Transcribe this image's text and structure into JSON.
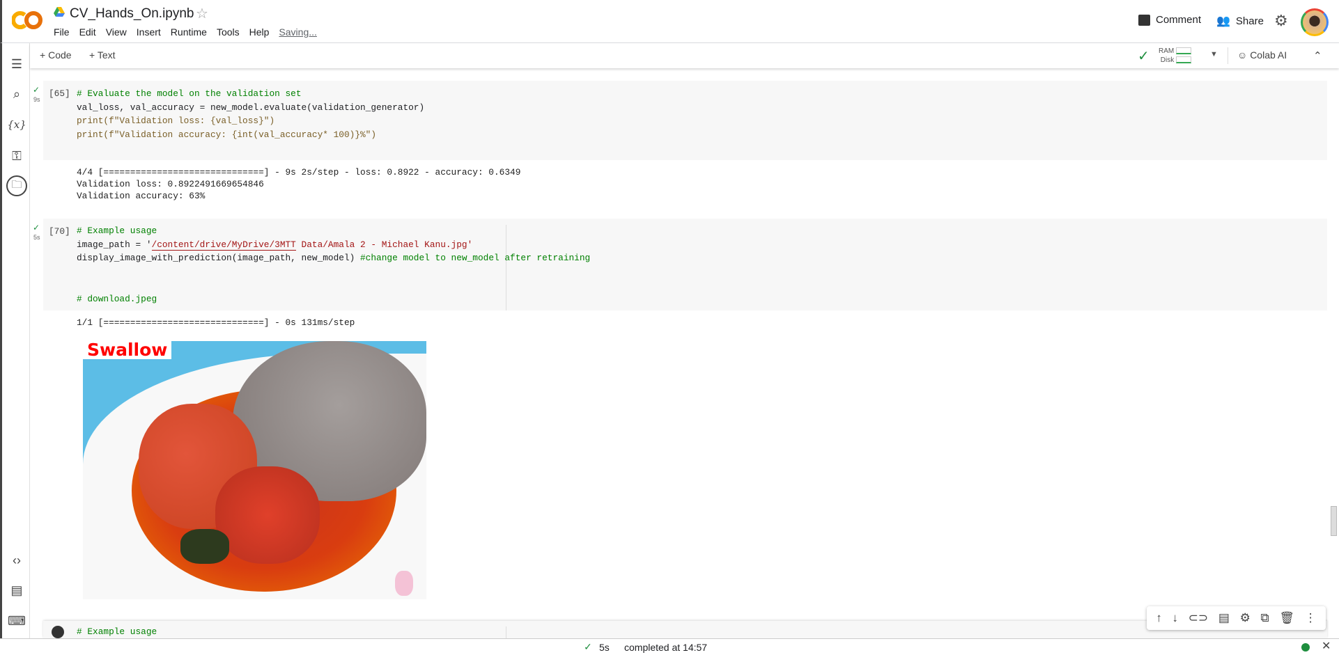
{
  "header": {
    "title": "CV_Hands_On.ipynb",
    "menu": [
      "File",
      "Edit",
      "View",
      "Insert",
      "Runtime",
      "Tools",
      "Help"
    ],
    "saving": "Saving...",
    "comment": "Comment",
    "share": "Share"
  },
  "toolbar": {
    "add_code": "Code",
    "add_text": "Text",
    "ram": "RAM",
    "disk": "Disk",
    "colab_ai": "Colab AI"
  },
  "cells": [
    {
      "count": "[65]",
      "duration": "9s",
      "code": [
        "# Evaluate the model on the validation set",
        "val_loss, val_accuracy = new_model.evaluate(validation_generator)",
        "print(f\"Validation loss: {val_loss}\")",
        "print(f\"Validation accuracy: {int(val_accuracy* 100)}%\")"
      ],
      "output": [
        "4/4 [==============================] - 9s 2s/step - loss: 0.8922 - accuracy: 0.6349",
        "Validation loss: 0.8922491669654846",
        "Validation accuracy: 63%"
      ]
    },
    {
      "count": "[70]",
      "duration": "5s",
      "code": [
        "# Example usage",
        "image_path = '",
        "/content/drive/MyDrive/3MTT",
        " Data/Amala 2 - Michael Kanu.jpg'",
        "display_image_with_prediction(image_path, new_model)",
        " #change model to new_model after retraining",
        "# download.jpeg"
      ],
      "output": [
        "1/1 [==============================] - 0s 131ms/step"
      ],
      "prediction_label": "Swallow"
    },
    {
      "code": [
        "# Example usage"
      ]
    }
  ],
  "statusbar": {
    "duration": "5s",
    "completed": "completed at 14:57"
  },
  "colors": {
    "accent": "#f9ab00",
    "success": "#1e8e3e",
    "label": "#ff0000"
  }
}
